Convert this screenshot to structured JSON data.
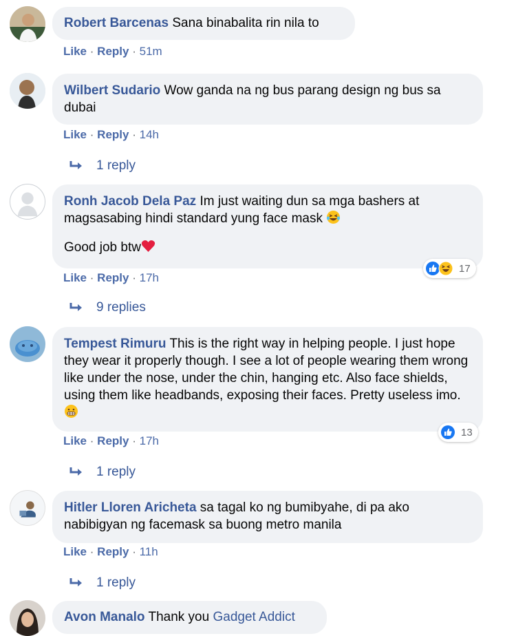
{
  "actions": {
    "like": "Like",
    "reply": "Reply",
    "separator": "·"
  },
  "colors": {
    "link": "#385898",
    "bubble": "#f0f2f5",
    "muted": "#65676b",
    "like_blue": "#1877f2",
    "heart_red": "#e41e3f"
  },
  "comments": [
    {
      "author": "Robert Barcenas",
      "text": "Sana binabalita rin nila to",
      "time": "51m"
    },
    {
      "author": "Wilbert Sudario",
      "text": "Wow ganda na ng bus parang design ng bus sa dubai",
      "time": "14h",
      "replies": "1 reply"
    },
    {
      "author": "Ronh Jacob Dela Paz",
      "text": "Im just waiting dun sa mga bashers at magsasabing hindi standard yung face mask",
      "text_emoji": "laughing-tears-emoji",
      "text2": "Good job btw",
      "text2_emoji": "red-heart-emoji",
      "time": "17h",
      "reaction_icons": [
        "like-reaction-icon",
        "haha-reaction-icon"
      ],
      "reaction_count": "17",
      "replies": "9 replies"
    },
    {
      "author": "Tempest Rimuru",
      "text": "This is the right way in helping people. I just hope they wear it properly though. I see a lot of people wearing them wrong like under the nose, under the chin, hanging etc. Also face shields, using them like headbands, exposing their faces. Pretty useless imo.",
      "text_emoji": "grimacing-face-emoji",
      "time": "17h",
      "reaction_icons": [
        "like-reaction-icon"
      ],
      "reaction_count": "13",
      "replies": "1 reply"
    },
    {
      "author": "Hitler Lloren Aricheta",
      "text": "sa tagal ko ng bumibyahe, di pa ako nabibigyan ng facemask sa buong metro manila",
      "time": "11h",
      "replies": "1 reply"
    },
    {
      "author": "Avon Manalo",
      "text": "Thank you",
      "mention": "Gadget Addict"
    }
  ]
}
